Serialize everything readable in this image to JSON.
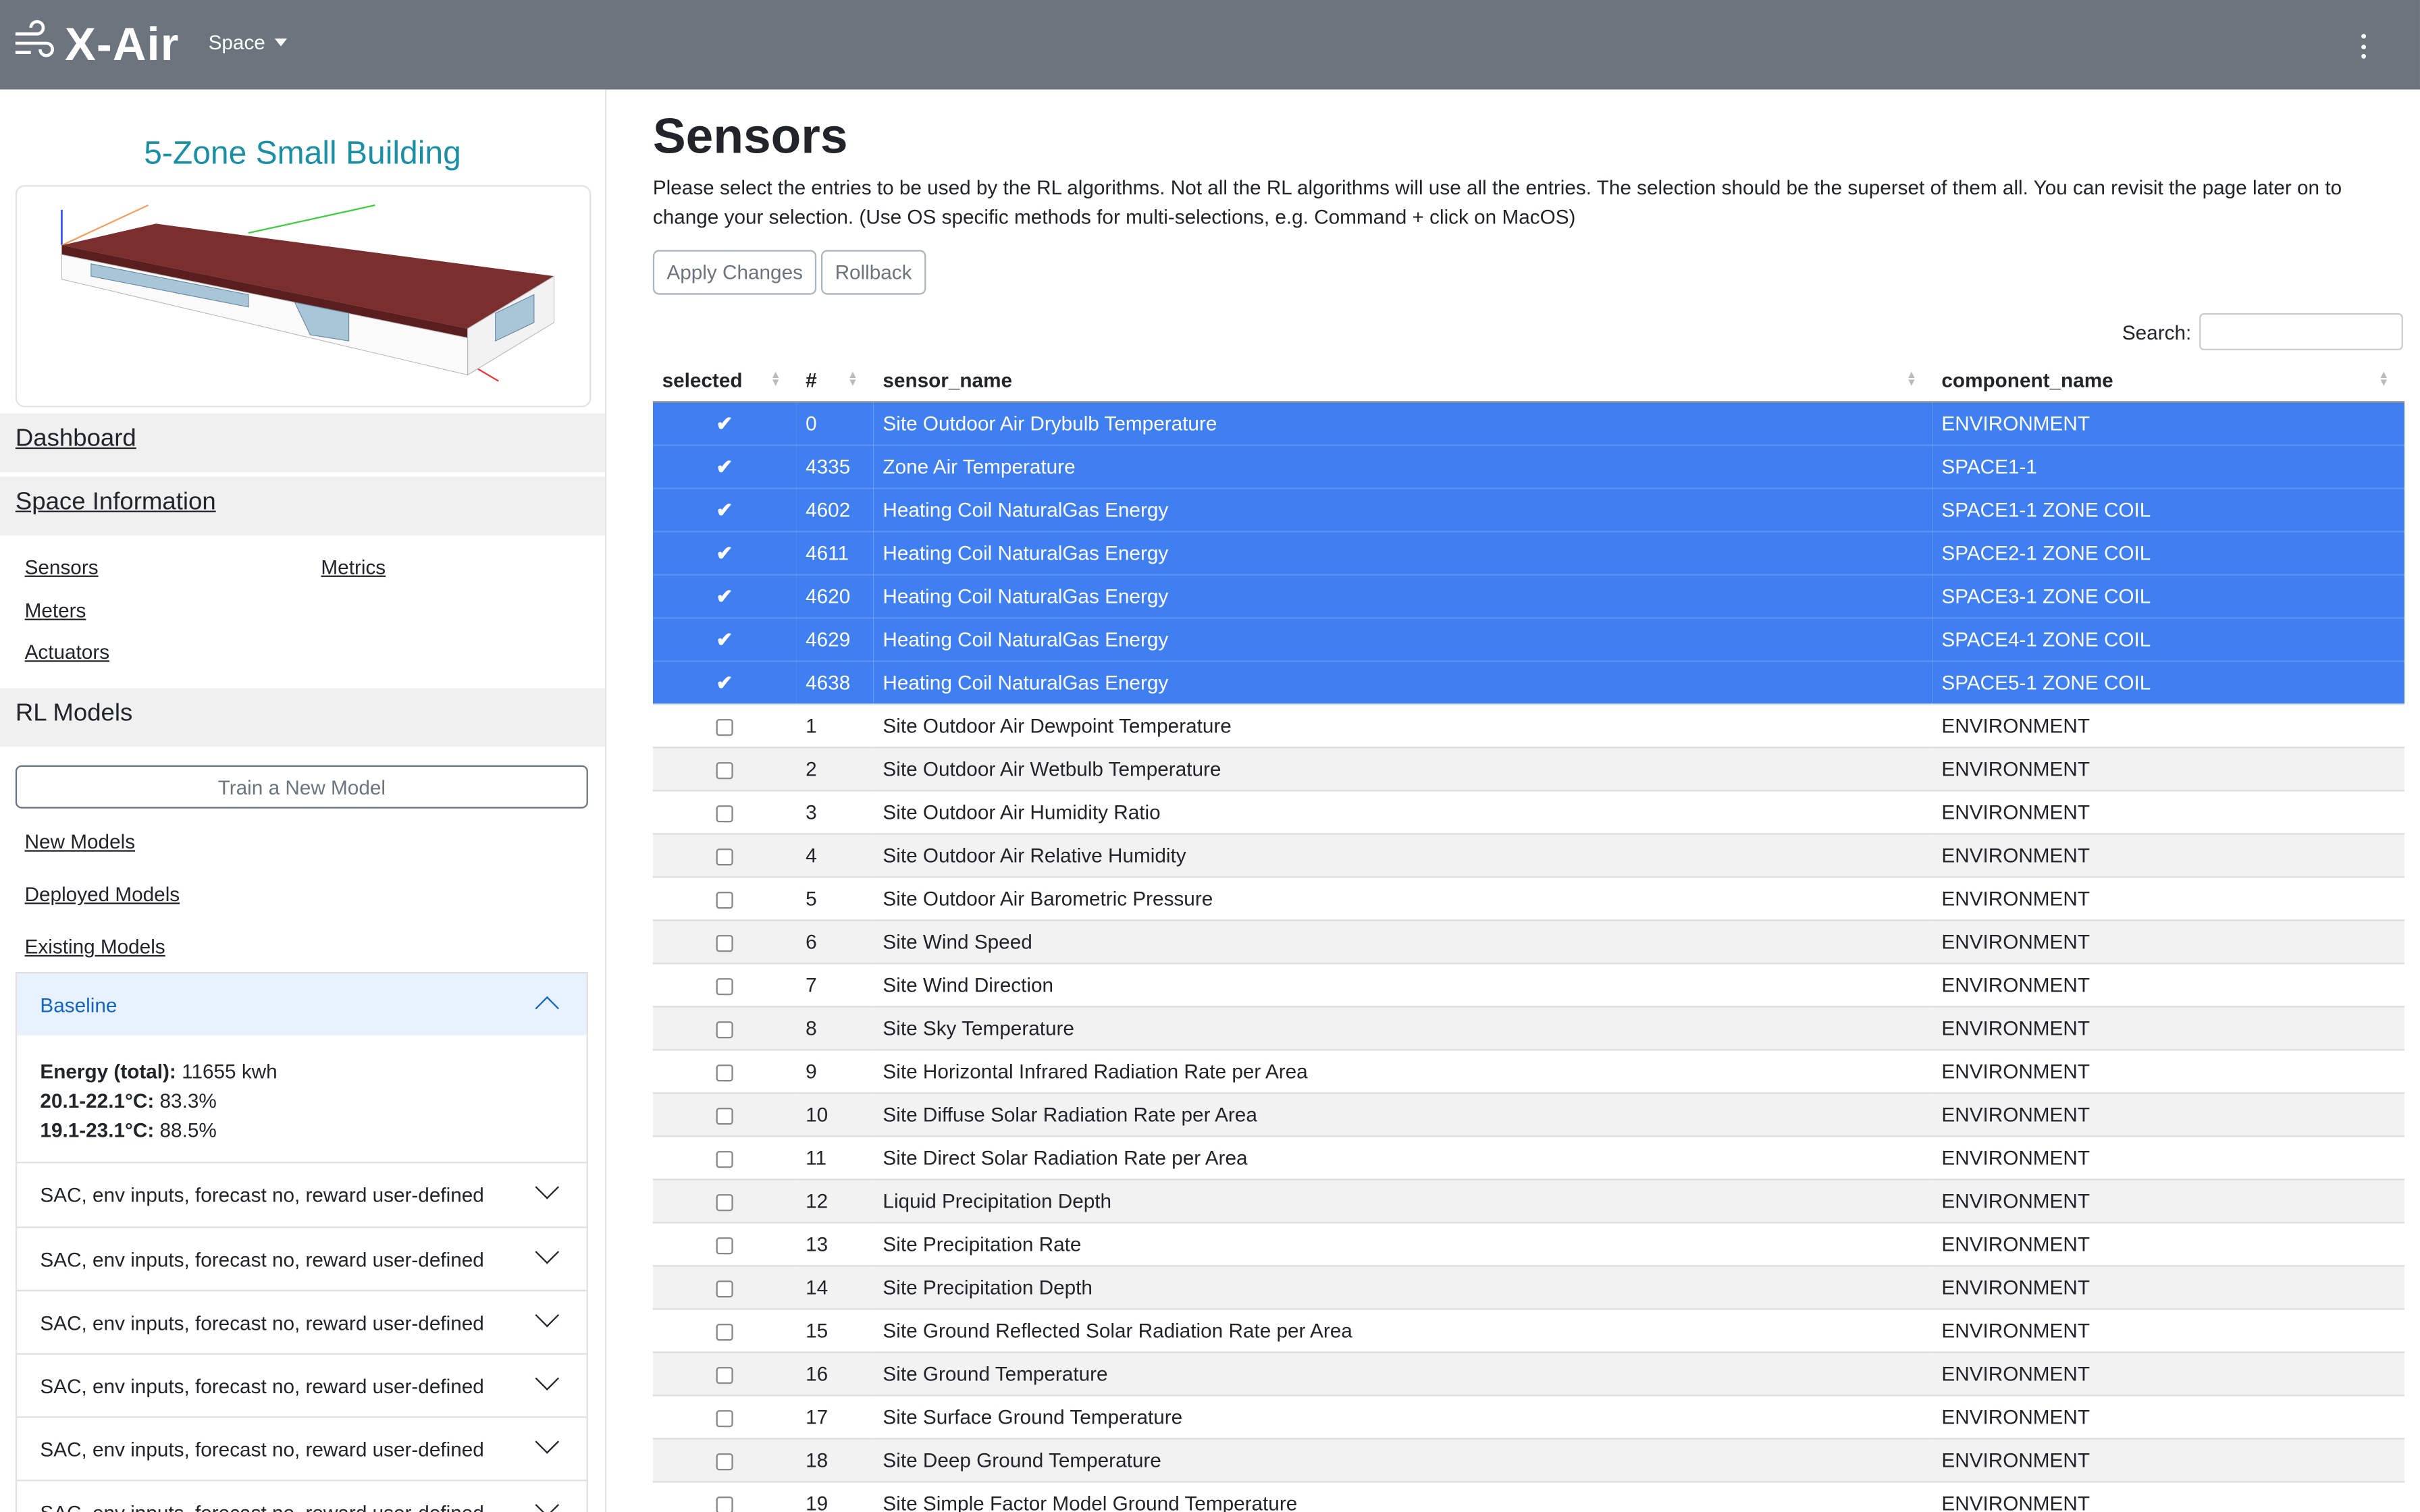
{
  "navbar": {
    "brand": "X-Air",
    "space_menu": "Space"
  },
  "sidebar": {
    "building_title": "5-Zone Small Building",
    "dashboard": "Dashboard",
    "space_information": "Space Information",
    "links": {
      "sensors": "Sensors",
      "metrics": "Metrics",
      "meters": "Meters",
      "actuators": "Actuators"
    },
    "rl_models": "RL Models",
    "train_button": "Train a New Model",
    "new_models": "New Models",
    "deployed_models": "Deployed Models",
    "existing_models": "Existing Models",
    "baseline": {
      "title": "Baseline",
      "energy_label": "Energy (total):",
      "energy_value": "11655 kwh",
      "range1_label": "20.1-22.1°C:",
      "range1_value": "83.3%",
      "range2_label": "19.1-23.1°C:",
      "range2_value": "88.5%"
    },
    "models": [
      "SAC, env inputs, forecast no, reward user-defined",
      "SAC, env inputs, forecast no, reward user-defined",
      "SAC, env inputs, forecast no, reward user-defined",
      "SAC, env inputs, forecast no, reward user-defined",
      "SAC, env inputs, forecast no, reward user-defined",
      "SAC, env inputs, forecast no, reward user-defined"
    ]
  },
  "main": {
    "title": "Sensors",
    "description": "Please select the entries to be used by the RL algorithms. Not all the RL algorithms will use all the entries. The selection should be the superset of them all. You can revisit the page later on to change your selection. (Use OS specific methods for multi-selections, e.g. Command + click on MacOS)",
    "apply_button": "Apply Changes",
    "rollback_button": "Rollback",
    "search_label": "Search:",
    "search_value": "",
    "columns": [
      "selected",
      "#",
      "sensor_name",
      "component_name"
    ],
    "colors": {
      "selected_row": "#3f7ff0",
      "navbar": "#6c757d",
      "title_teal": "#1a8fa3"
    },
    "rows": [
      {
        "selected": true,
        "id": "0",
        "sensor": "Site Outdoor Air Drybulb Temperature",
        "component": "ENVIRONMENT"
      },
      {
        "selected": true,
        "id": "4335",
        "sensor": "Zone Air Temperature",
        "component": "SPACE1-1"
      },
      {
        "selected": true,
        "id": "4602",
        "sensor": "Heating Coil NaturalGas Energy",
        "component": "SPACE1-1 ZONE COIL"
      },
      {
        "selected": true,
        "id": "4611",
        "sensor": "Heating Coil NaturalGas Energy",
        "component": "SPACE2-1 ZONE COIL"
      },
      {
        "selected": true,
        "id": "4620",
        "sensor": "Heating Coil NaturalGas Energy",
        "component": "SPACE3-1 ZONE COIL"
      },
      {
        "selected": true,
        "id": "4629",
        "sensor": "Heating Coil NaturalGas Energy",
        "component": "SPACE4-1 ZONE COIL"
      },
      {
        "selected": true,
        "id": "4638",
        "sensor": "Heating Coil NaturalGas Energy",
        "component": "SPACE5-1 ZONE COIL"
      },
      {
        "selected": false,
        "id": "1",
        "sensor": "Site Outdoor Air Dewpoint Temperature",
        "component": "ENVIRONMENT"
      },
      {
        "selected": false,
        "id": "2",
        "sensor": "Site Outdoor Air Wetbulb Temperature",
        "component": "ENVIRONMENT"
      },
      {
        "selected": false,
        "id": "3",
        "sensor": "Site Outdoor Air Humidity Ratio",
        "component": "ENVIRONMENT"
      },
      {
        "selected": false,
        "id": "4",
        "sensor": "Site Outdoor Air Relative Humidity",
        "component": "ENVIRONMENT"
      },
      {
        "selected": false,
        "id": "5",
        "sensor": "Site Outdoor Air Barometric Pressure",
        "component": "ENVIRONMENT"
      },
      {
        "selected": false,
        "id": "6",
        "sensor": "Site Wind Speed",
        "component": "ENVIRONMENT"
      },
      {
        "selected": false,
        "id": "7",
        "sensor": "Site Wind Direction",
        "component": "ENVIRONMENT"
      },
      {
        "selected": false,
        "id": "8",
        "sensor": "Site Sky Temperature",
        "component": "ENVIRONMENT"
      },
      {
        "selected": false,
        "id": "9",
        "sensor": "Site Horizontal Infrared Radiation Rate per Area",
        "component": "ENVIRONMENT"
      },
      {
        "selected": false,
        "id": "10",
        "sensor": "Site Diffuse Solar Radiation Rate per Area",
        "component": "ENVIRONMENT"
      },
      {
        "selected": false,
        "id": "11",
        "sensor": "Site Direct Solar Radiation Rate per Area",
        "component": "ENVIRONMENT"
      },
      {
        "selected": false,
        "id": "12",
        "sensor": "Liquid Precipitation Depth",
        "component": "ENVIRONMENT"
      },
      {
        "selected": false,
        "id": "13",
        "sensor": "Site Precipitation Rate",
        "component": "ENVIRONMENT"
      },
      {
        "selected": false,
        "id": "14",
        "sensor": "Site Precipitation Depth",
        "component": "ENVIRONMENT"
      },
      {
        "selected": false,
        "id": "15",
        "sensor": "Site Ground Reflected Solar Radiation Rate per Area",
        "component": "ENVIRONMENT"
      },
      {
        "selected": false,
        "id": "16",
        "sensor": "Site Ground Temperature",
        "component": "ENVIRONMENT"
      },
      {
        "selected": false,
        "id": "17",
        "sensor": "Site Surface Ground Temperature",
        "component": "ENVIRONMENT"
      },
      {
        "selected": false,
        "id": "18",
        "sensor": "Site Deep Ground Temperature",
        "component": "ENVIRONMENT"
      },
      {
        "selected": false,
        "id": "19",
        "sensor": "Site Simple Factor Model Ground Temperature",
        "component": "ENVIRONMENT"
      }
    ]
  }
}
